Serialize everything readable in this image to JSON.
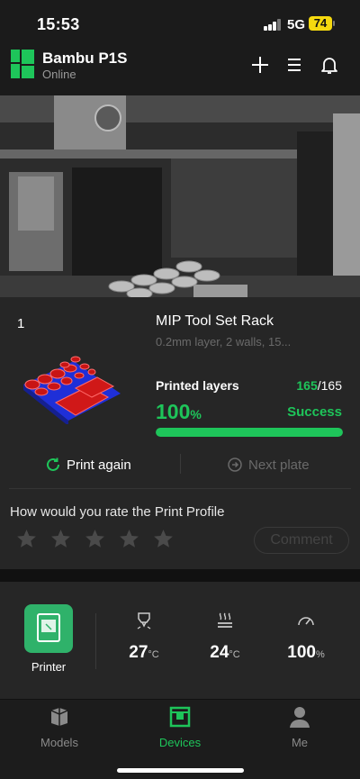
{
  "status_bar": {
    "time": "15:53",
    "network": "5G",
    "battery": "74"
  },
  "header": {
    "device_name": "Bambu P1S",
    "device_status": "Online"
  },
  "job": {
    "plate_number": "1",
    "title": "MIP Tool Set Rack",
    "subtitle": "0.2mm layer, 2 walls, 15...",
    "layers_label": "Printed layers",
    "layers_current": "165",
    "layers_total": "/165",
    "progress_value": "100",
    "progress_unit": "%",
    "progress_fraction": 1.0,
    "result": "Success",
    "print_again": "Print again",
    "next_plate": "Next plate",
    "rate_question": "How would you rate the Print Profile",
    "stars_total": 5,
    "comment": "Comment"
  },
  "stats": {
    "printer_label": "Printer",
    "nozzle_temp": "27",
    "nozzle_unit": "°C",
    "bed_temp": "24",
    "bed_unit": "°C",
    "speed": "100",
    "speed_unit": "%"
  },
  "tabs": {
    "models": "Models",
    "devices": "Devices",
    "me": "Me"
  },
  "colors": {
    "accent": "#1ec55a",
    "printer_tile": "#2fb26a",
    "battery": "#f5d90f"
  }
}
